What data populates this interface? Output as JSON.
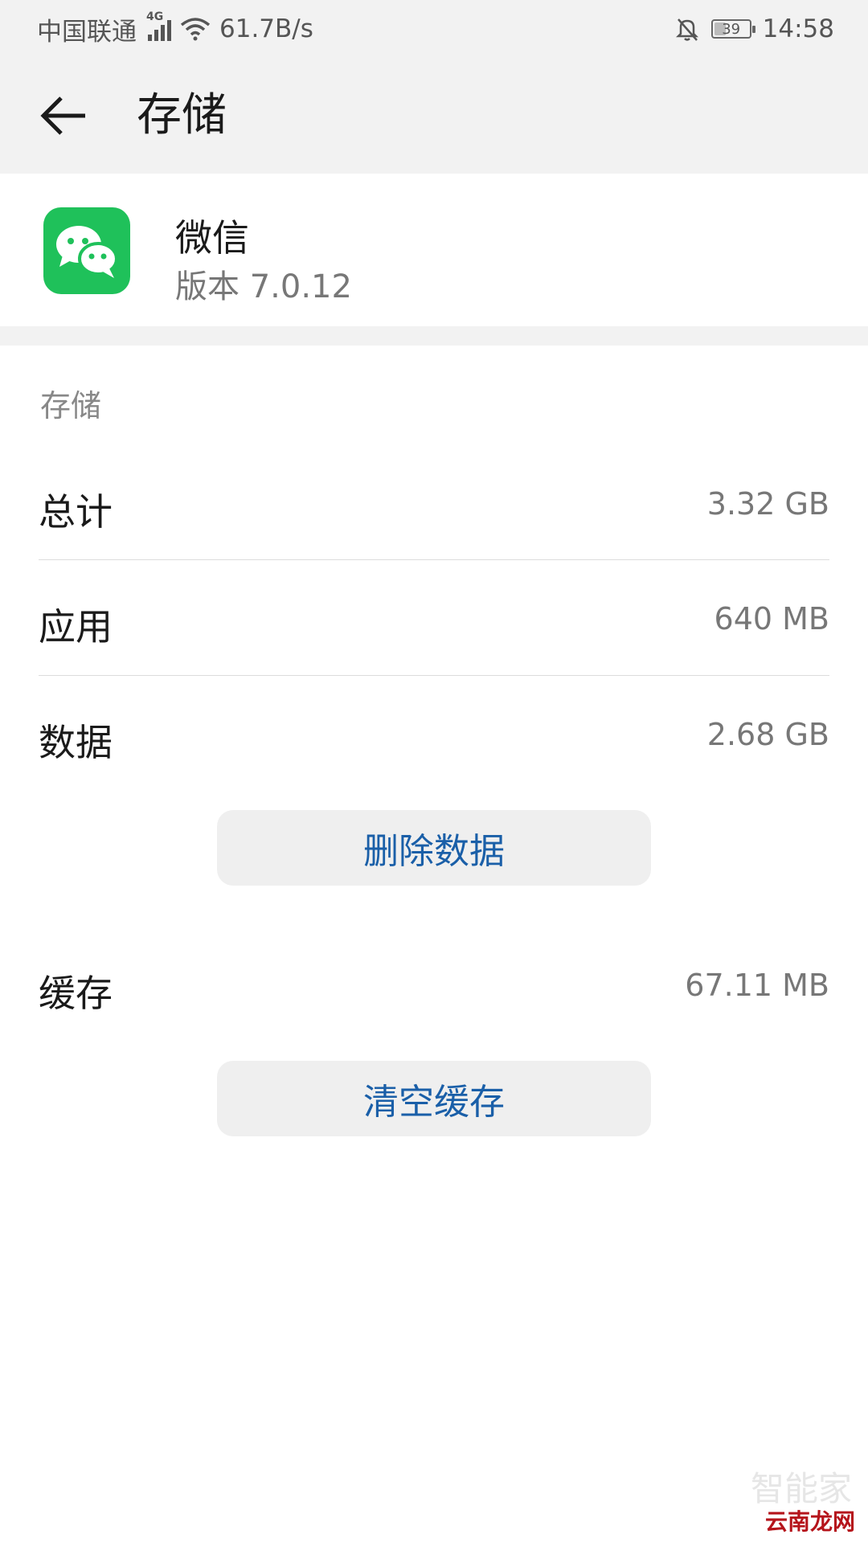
{
  "status_bar": {
    "carrier": "中国联通",
    "network_type": "4G",
    "speed": "61.7B/s",
    "battery": "39",
    "battery_level_percent": 39,
    "time": "14:58"
  },
  "toolbar": {
    "title": "存储"
  },
  "app": {
    "name": "微信",
    "version": "版本 7.0.12",
    "icon_color": "#1fc15a"
  },
  "storage": {
    "section_label": "存储",
    "rows": [
      {
        "label": "总计",
        "value": "3.32 GB"
      },
      {
        "label": "应用",
        "value": "640 MB"
      },
      {
        "label": "数据",
        "value": "2.68 GB"
      }
    ],
    "delete_data_label": "删除数据",
    "cache": {
      "label": "缓存",
      "value": "67.11 MB"
    },
    "clear_cache_label": "清空缓存"
  },
  "watermark": {
    "text": "云南龙网",
    "faint_text": "智能家"
  },
  "colors": {
    "accent": "#1a5fa8",
    "background": "#f2f2f2"
  }
}
